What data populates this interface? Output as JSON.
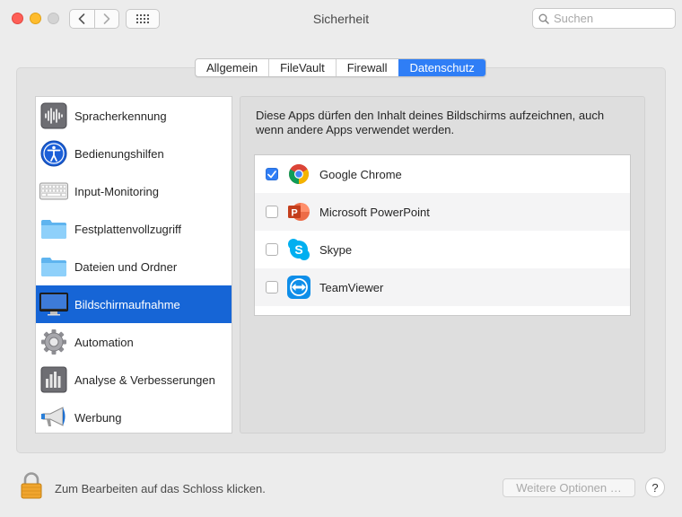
{
  "window": {
    "title": "Sicherheit"
  },
  "search": {
    "placeholder": "Suchen"
  },
  "tabs": [
    {
      "label": "Allgemein",
      "active": false
    },
    {
      "label": "FileVault",
      "active": false
    },
    {
      "label": "Firewall",
      "active": false
    },
    {
      "label": "Datenschutz",
      "active": true
    }
  ],
  "sidebar": {
    "items": [
      {
        "label": "Spracherkennung",
        "icon": "waveform-icon",
        "selected": false
      },
      {
        "label": "Bedienungshilfen",
        "icon": "accessibility-icon",
        "selected": false
      },
      {
        "label": "Input-Monitoring",
        "icon": "keyboard-icon",
        "selected": false
      },
      {
        "label": "Festplattenvollzugriff",
        "icon": "folder-icon",
        "selected": false
      },
      {
        "label": "Dateien und Ordner",
        "icon": "folder-icon",
        "selected": false
      },
      {
        "label": "Bildschirmaufnahme",
        "icon": "display-icon",
        "selected": true
      },
      {
        "label": "Automation",
        "icon": "gear-icon",
        "selected": false
      },
      {
        "label": "Analyse & Verbesserungen",
        "icon": "bar-chart-icon",
        "selected": false
      },
      {
        "label": "Werbung",
        "icon": "megaphone-icon",
        "selected": false
      }
    ]
  },
  "panel": {
    "description_line1": "Diese Apps dürfen den Inhalt deines Bildschirms aufzeichnen, auch",
    "description_line2": "wenn andere Apps verwendet werden.",
    "apps": [
      {
        "name": "Google Chrome",
        "checked": true,
        "icon": "chrome-icon"
      },
      {
        "name": "Microsoft PowerPoint",
        "checked": false,
        "icon": "powerpoint-icon"
      },
      {
        "name": "Skype",
        "checked": false,
        "icon": "skype-icon"
      },
      {
        "name": "TeamViewer",
        "checked": false,
        "icon": "teamviewer-icon"
      }
    ]
  },
  "footer": {
    "lock_text": "Zum Bearbeiten auf das Schloss klicken.",
    "more_options_label": "Weitere Optionen …",
    "help_label": "?"
  },
  "colors": {
    "accent": "#2f7ef6",
    "selection": "#1665d6",
    "window_bg": "#ececec"
  }
}
